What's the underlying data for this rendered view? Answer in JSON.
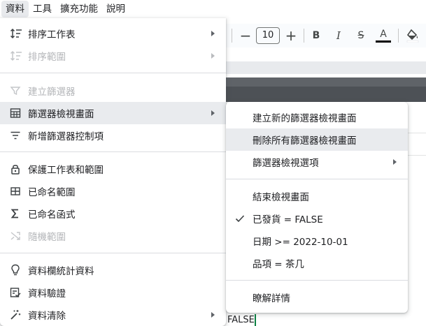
{
  "menubar": {
    "items": [
      "資料",
      "工具",
      "擴充功能",
      "說明"
    ]
  },
  "toolbar": {
    "font_size": "10",
    "minus_label": "−",
    "plus_label": "+",
    "bold_label": "B",
    "italic_label": "I",
    "strike_label": "S",
    "text_color_label": "A"
  },
  "sheet": {
    "cell_text": "FALSE"
  },
  "data_menu": {
    "items": [
      {
        "label": "排序工作表",
        "icon": "sort-icon",
        "disabled": false,
        "submenu": true
      },
      {
        "label": "排序範圍",
        "icon": "sort-range-icon",
        "disabled": true,
        "submenu": true
      },
      {
        "label": "建立篩選器",
        "icon": "filter-icon",
        "disabled": true,
        "submenu": false
      },
      {
        "label": "篩選器檢視畫面",
        "icon": "filter-view-icon",
        "disabled": false,
        "submenu": true,
        "highlighted": true
      },
      {
        "label": "新增篩選器控制項",
        "icon": "slicer-icon",
        "disabled": false,
        "submenu": false
      },
      {
        "label": "保護工作表和範圍",
        "icon": "lock-icon",
        "disabled": false,
        "submenu": false
      },
      {
        "label": "已命名範圍",
        "icon": "named-range-icon",
        "disabled": false,
        "submenu": false
      },
      {
        "label": "已命名函式",
        "icon": "sigma-icon",
        "disabled": false,
        "submenu": false
      },
      {
        "label": "隨機範圍",
        "icon": "shuffle-icon",
        "disabled": true,
        "submenu": false
      },
      {
        "label": "資料欄統計資料",
        "icon": "lightbulb-icon",
        "disabled": false,
        "submenu": false
      },
      {
        "label": "資料驗證",
        "icon": "data-validation-icon",
        "disabled": false,
        "submenu": false
      },
      {
        "label": "資料清除",
        "icon": "magic-wand-icon",
        "disabled": false,
        "submenu": true
      }
    ]
  },
  "filter_views_submenu": {
    "items": [
      {
        "label": "建立新的篩選器檢視畫面",
        "submenu": false,
        "checked": false
      },
      {
        "label": "刪除所有篩選器檢視畫面",
        "submenu": false,
        "checked": false,
        "highlighted": true
      },
      {
        "label": "篩選器檢視選項",
        "submenu": true,
        "checked": false
      },
      {
        "label": "結束檢視畫面",
        "submenu": false,
        "checked": false
      },
      {
        "label": "已發貨 = FALSE",
        "submenu": false,
        "checked": true
      },
      {
        "label": "日期 >= 2022-10-01",
        "submenu": false,
        "checked": false
      },
      {
        "label": "品項 = 茶几",
        "submenu": false,
        "checked": false
      },
      {
        "label": "瞭解詳情",
        "submenu": false,
        "checked": false
      }
    ]
  },
  "colors": {
    "accent_green": "#0b8043",
    "highlight": "#e9ebee",
    "disabled_text": "#b4b6b9"
  }
}
